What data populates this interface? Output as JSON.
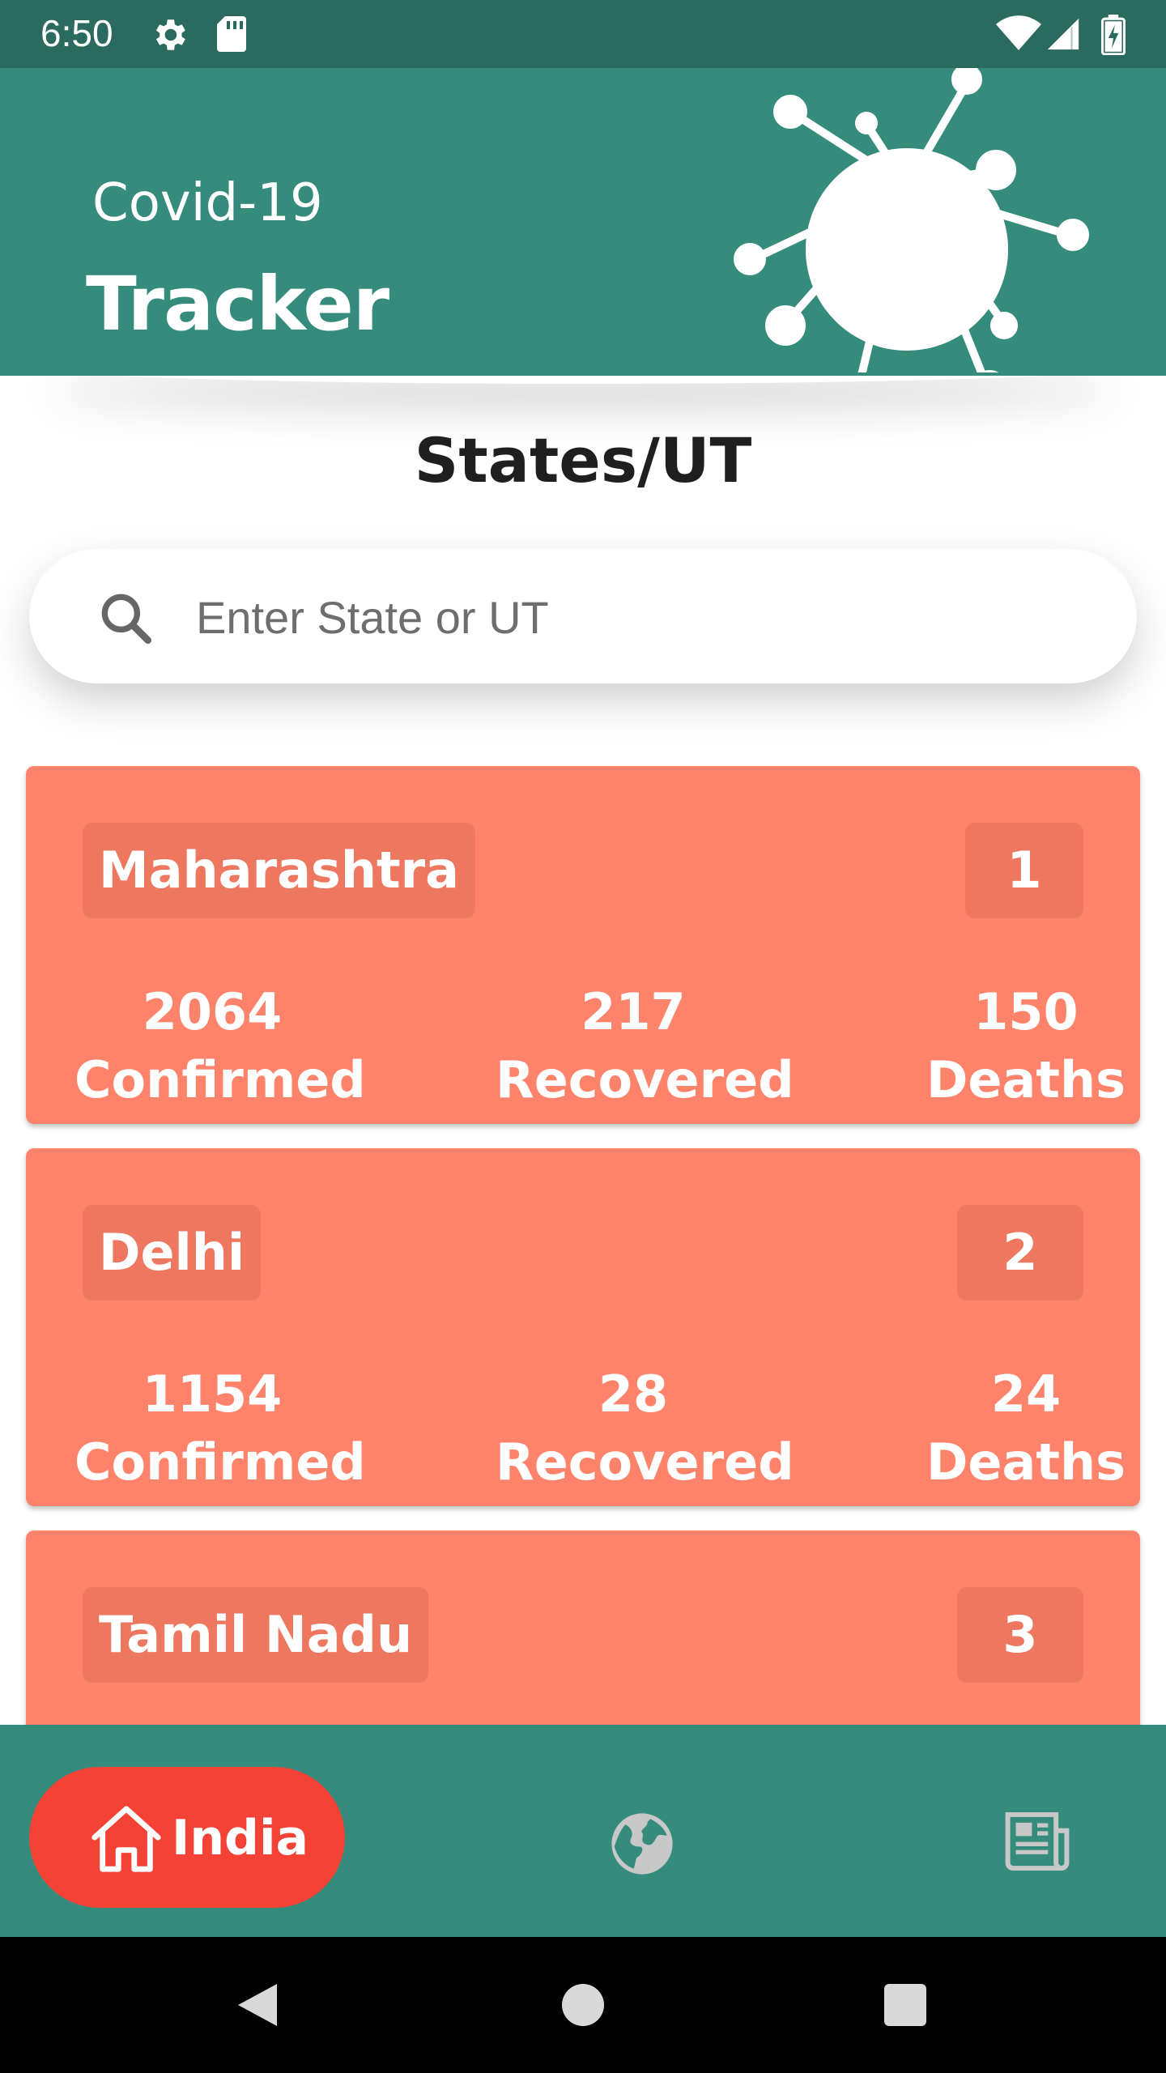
{
  "status_bar": {
    "time": "6:50"
  },
  "header": {
    "subtitle": "Covid-19",
    "title": "Tracker"
  },
  "section": {
    "title": "States/UT"
  },
  "search": {
    "placeholder": "Enter State or UT"
  },
  "states": [
    {
      "name": "Maharashtra",
      "rank": "1",
      "confirmed": "2064",
      "recovered": "217",
      "deaths": "150"
    },
    {
      "name": "Delhi",
      "rank": "2",
      "confirmed": "1154",
      "recovered": "28",
      "deaths": "24"
    },
    {
      "name": "Tamil Nadu",
      "rank": "3"
    }
  ],
  "labels": {
    "confirmed": "Confirmed",
    "recovered": "Recovered",
    "deaths": "Deaths"
  },
  "bottom_nav": {
    "india_label": "India",
    "icons": [
      "home-icon",
      "globe-icon",
      "newspaper-icon"
    ]
  },
  "colors": {
    "header": "#368c7c",
    "status_bar": "#2b6a5e",
    "card": "#ff836a",
    "card_badge": "#ee7760",
    "nav_active": "#f44336"
  }
}
